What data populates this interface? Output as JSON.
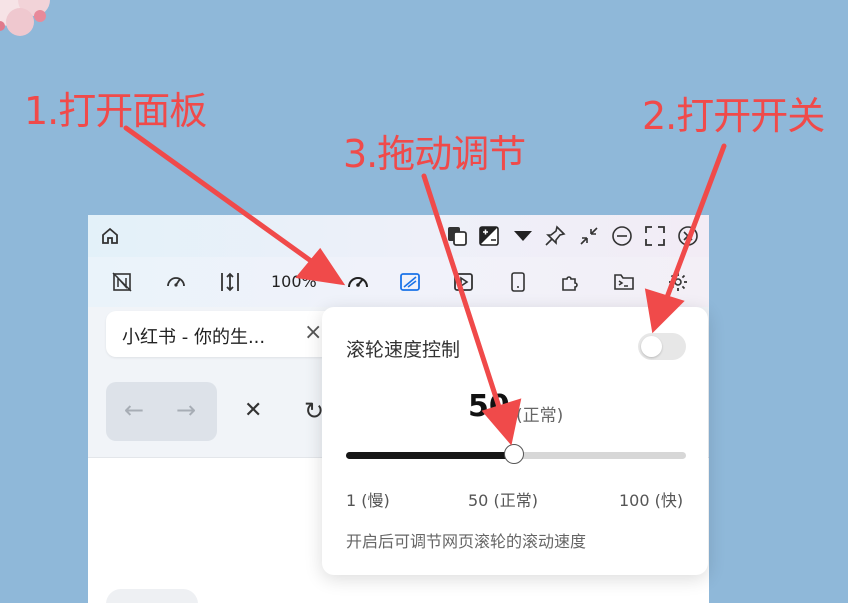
{
  "annotations": {
    "step1": "1.打开面板",
    "step2": "2.打开开关",
    "step3": "3.拖动调节"
  },
  "toolbar": {
    "zoom": "100%"
  },
  "tab": {
    "title": "小红书 - 你的生...",
    "close": "×"
  },
  "nav": {
    "back": "←",
    "forward": "→",
    "stop": "✕",
    "reload": "↻"
  },
  "panel": {
    "title": "滚轮速度控制",
    "toggle_on": false,
    "speed_value": "50",
    "speed_note": "(正常)",
    "slider": {
      "min": 1,
      "max": 100,
      "value": 50
    },
    "min_label": "1 (慢)",
    "mid_label": "50 (正常)",
    "max_label": "100 (快)",
    "description": "开启后可调节网页滚轮的滚动速度"
  },
  "colors": {
    "annotation": "#f04a4a",
    "accent": "#1a73e8",
    "background": "#8fb8d9"
  }
}
